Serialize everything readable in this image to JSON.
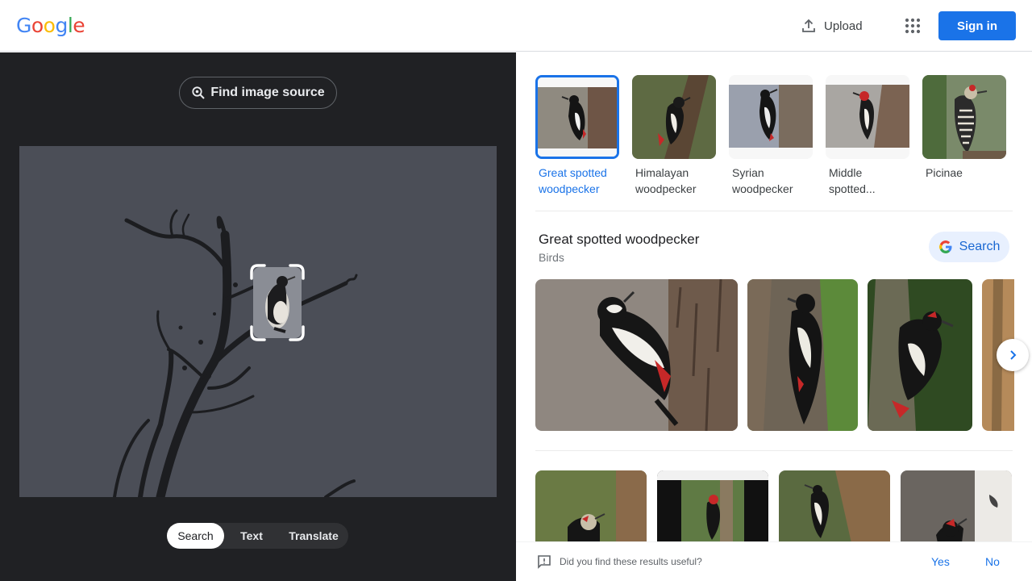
{
  "header": {
    "logo_letters": [
      {
        "ch": "G",
        "color": "#4285F4"
      },
      {
        "ch": "o",
        "color": "#EA4335"
      },
      {
        "ch": "o",
        "color": "#FBBC05"
      },
      {
        "ch": "g",
        "color": "#4285F4"
      },
      {
        "ch": "l",
        "color": "#34A853"
      },
      {
        "ch": "e",
        "color": "#EA4335"
      }
    ],
    "upload_label": "Upload",
    "upload_icon": "upload-icon",
    "apps_icon": "apps-grid-icon",
    "signin_label": "Sign in"
  },
  "left": {
    "find_source_label": "Find image source",
    "find_source_icon": "lens-search-icon",
    "modes": [
      "Search",
      "Text",
      "Translate"
    ],
    "active_mode": "Search"
  },
  "right": {
    "chips": [
      {
        "label": "Great spotted woodpecker",
        "selected": true
      },
      {
        "label": "Himalayan woodpecker",
        "selected": false
      },
      {
        "label": "Syrian woodpecker",
        "selected": false
      },
      {
        "label": "Middle spotted...",
        "selected": false
      },
      {
        "label": "Picinae",
        "selected": false
      }
    ],
    "knowledge": {
      "title": "Great spotted woodpecker",
      "subtitle": "Birds",
      "search_label": "Search"
    },
    "feedback": {
      "question": "Did you find these results useful?",
      "yes": "Yes",
      "no": "No"
    }
  },
  "colors": {
    "accent": "#1a73e8",
    "dark_panel": "#202124"
  }
}
